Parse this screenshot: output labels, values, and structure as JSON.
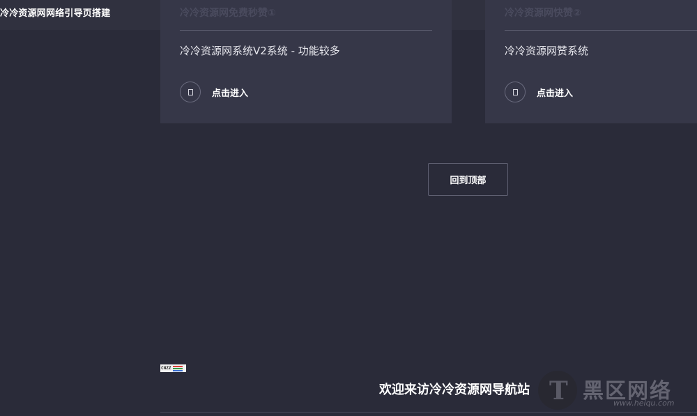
{
  "site": {
    "title": "冷冷资源网网络引导页搭建"
  },
  "cards": [
    {
      "heading": "冷冷资源网免费秒赞①",
      "description": "冷冷资源网系统V2系统 - 功能较多",
      "enter_label": "点击进入",
      "enter_icon": "link-icon"
    },
    {
      "heading": "冷冷资源网快赞②",
      "description": "冷冷资源网赞系统",
      "enter_label": "点击进入",
      "enter_icon": "link-icon"
    }
  ],
  "back_to_top": {
    "label": "回到顶部"
  },
  "badge": {
    "text": "CNZZ",
    "colors": [
      "#d9413a",
      "#3a9a4a",
      "#3b6fd1"
    ]
  },
  "footer": {
    "welcome": "欢迎来访冷冷资源网导航站"
  },
  "watermark": {
    "logo_letter": "T",
    "name": "黑区网络",
    "url": "www.heiqu.com"
  },
  "colors": {
    "background": "#2a2b39",
    "card": "#363748",
    "border": "#5f6072"
  }
}
